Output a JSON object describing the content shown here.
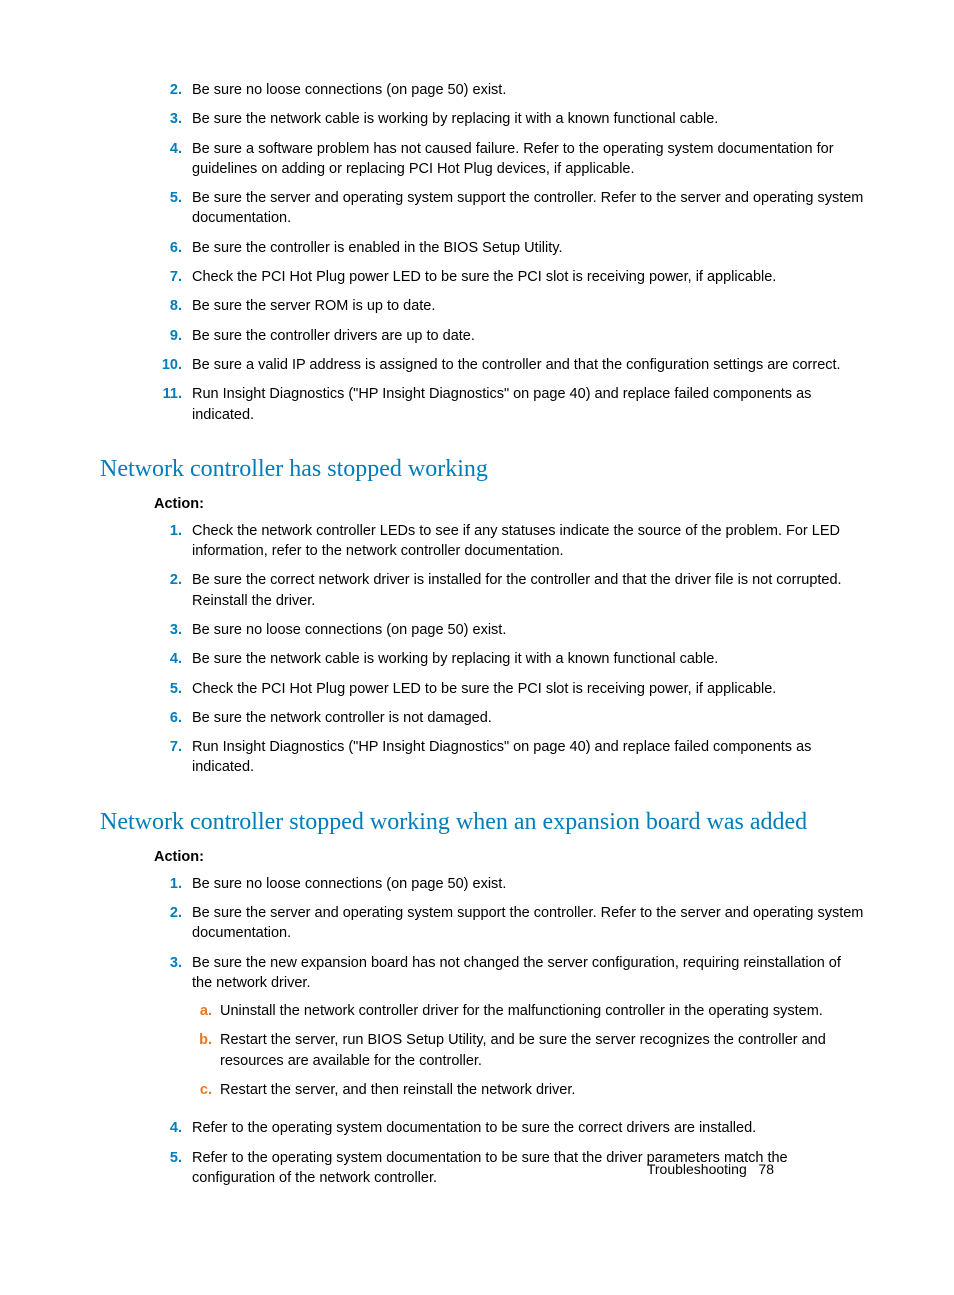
{
  "section1_items": [
    {
      "n": "2.",
      "t": "Be sure no loose connections (on page 50) exist."
    },
    {
      "n": "3.",
      "t": "Be sure the network cable is working by replacing it with a known functional cable."
    },
    {
      "n": "4.",
      "t": "Be sure a software problem has not caused failure. Refer to the operating system documentation for guidelines on adding or replacing PCI Hot Plug devices, if applicable."
    },
    {
      "n": "5.",
      "t": "Be sure the server and operating system support the controller. Refer to the server and operating system documentation."
    },
    {
      "n": "6.",
      "t": "Be sure the controller is enabled in the BIOS Setup Utility."
    },
    {
      "n": "7.",
      "t": "Check the PCI Hot Plug power LED to be sure the PCI slot is receiving power, if applicable."
    },
    {
      "n": "8.",
      "t": "Be sure the server ROM is up to date."
    },
    {
      "n": "9.",
      "t": "Be sure the controller drivers are up to date."
    },
    {
      "n": "10.",
      "t": "Be sure a valid IP address is assigned to the controller and that the configuration settings are correct."
    },
    {
      "n": "11.",
      "t": "Run Insight Diagnostics (\"HP Insight Diagnostics\" on page 40) and replace failed components as indicated."
    }
  ],
  "heading2": "Network controller has stopped working",
  "action_label": "Action:",
  "section2_items": [
    {
      "n": "1.",
      "t": "Check the network controller LEDs to see if any statuses indicate the source of the problem. For LED information, refer to the network controller documentation."
    },
    {
      "n": "2.",
      "t": "Be sure the correct network driver is installed for the controller and that the driver file is not corrupted. Reinstall the driver."
    },
    {
      "n": "3.",
      "t": "Be sure no loose connections (on page 50) exist."
    },
    {
      "n": "4.",
      "t": "Be sure the network cable is working by replacing it with a known functional cable."
    },
    {
      "n": "5.",
      "t": "Check the PCI Hot Plug power LED to be sure the PCI slot is receiving power, if applicable."
    },
    {
      "n": "6.",
      "t": "Be sure the network controller is not damaged."
    },
    {
      "n": "7.",
      "t": "Run Insight Diagnostics (\"HP Insight Diagnostics\" on page 40) and replace failed components as indicated."
    }
  ],
  "heading3": "Network controller stopped working when an expansion board was added",
  "section3_items": [
    {
      "n": "1.",
      "t": "Be sure no loose connections (on page 50) exist."
    },
    {
      "n": "2.",
      "t": "Be sure the server and operating system support the controller. Refer to the server and operating system documentation."
    },
    {
      "n": "3.",
      "t": "Be sure the new expansion board has not changed the server configuration, requiring reinstallation of the network driver.",
      "sub": [
        {
          "n": "a.",
          "t": "Uninstall the network controller driver for the malfunctioning controller in the operating system."
        },
        {
          "n": "b.",
          "t": "Restart the server, run BIOS Setup Utility, and be sure the server recognizes the controller and resources are available for the controller."
        },
        {
          "n": "c.",
          "t": "Restart the server, and then reinstall the network driver."
        }
      ]
    },
    {
      "n": "4.",
      "t": "Refer to the operating system documentation to be sure the correct drivers are installed."
    },
    {
      "n": "5.",
      "t": "Refer to the operating system documentation to be sure that the driver parameters match the configuration of the network controller."
    }
  ],
  "footer_section": "Troubleshooting",
  "footer_page": "78"
}
